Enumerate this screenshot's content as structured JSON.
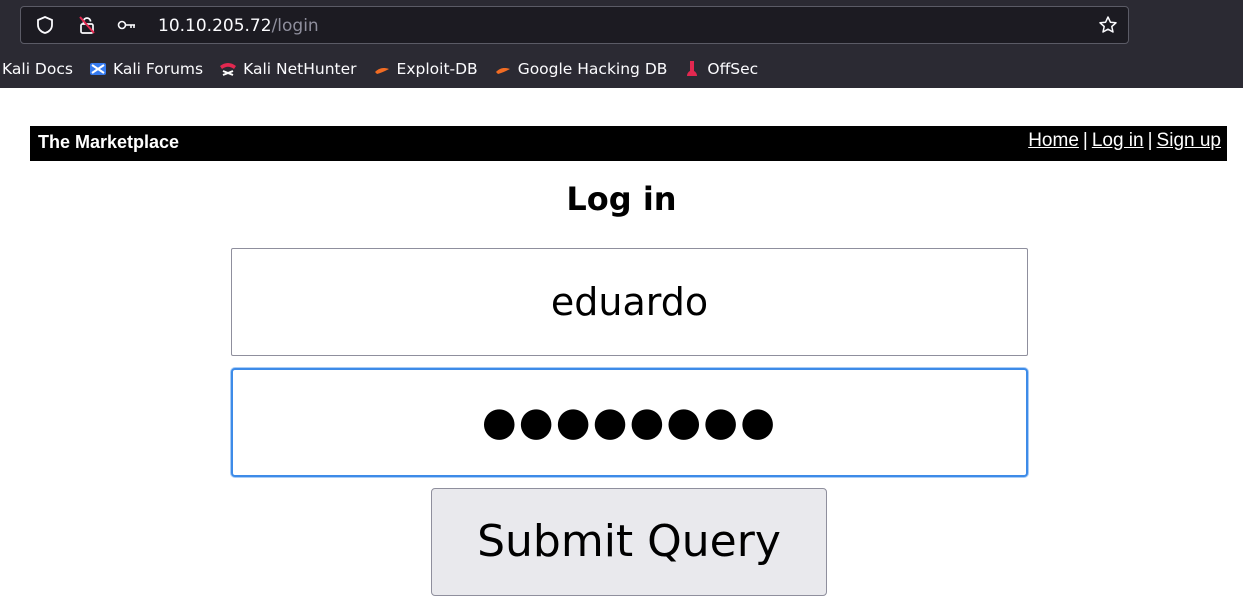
{
  "browser": {
    "url_host": "10.10.205.72",
    "url_path": "/login",
    "bookmarks": [
      {
        "label": "Kali Docs",
        "icon": "kali-docs-icon"
      },
      {
        "label": "Kali Forums",
        "icon": "kali-forums-icon"
      },
      {
        "label": "Kali NetHunter",
        "icon": "kali-nethunter-icon"
      },
      {
        "label": "Exploit-DB",
        "icon": "exploit-db-icon"
      },
      {
        "label": "Google Hacking DB",
        "icon": "google-hacking-db-icon"
      },
      {
        "label": "OffSec",
        "icon": "offsec-icon"
      }
    ]
  },
  "site": {
    "brand": "The Marketplace",
    "nav": {
      "home": "Home",
      "login": "Log in",
      "signup": "Sign up",
      "separator": "|"
    }
  },
  "form": {
    "title": "Log in",
    "username_value": "eduardo",
    "password_mask": "●●●●●●●●",
    "submit_label": "Submit Query"
  }
}
